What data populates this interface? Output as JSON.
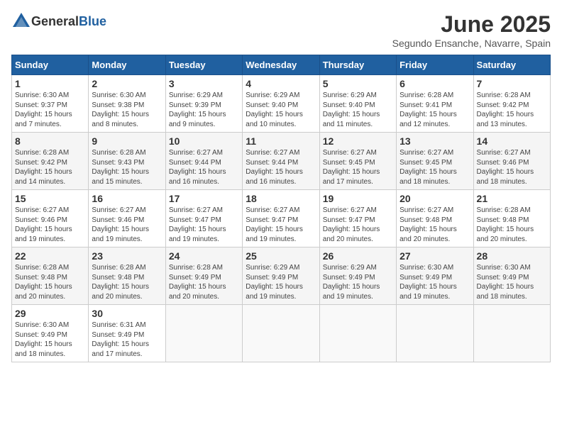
{
  "header": {
    "logo_general": "General",
    "logo_blue": "Blue",
    "month_title": "June 2025",
    "subtitle": "Segundo Ensanche, Navarre, Spain"
  },
  "weekdays": [
    "Sunday",
    "Monday",
    "Tuesday",
    "Wednesday",
    "Thursday",
    "Friday",
    "Saturday"
  ],
  "weeks": [
    [
      {
        "day": "1",
        "sunrise": "Sunrise: 6:30 AM",
        "sunset": "Sunset: 9:37 PM",
        "daylight": "Daylight: 15 hours and 7 minutes."
      },
      {
        "day": "2",
        "sunrise": "Sunrise: 6:30 AM",
        "sunset": "Sunset: 9:38 PM",
        "daylight": "Daylight: 15 hours and 8 minutes."
      },
      {
        "day": "3",
        "sunrise": "Sunrise: 6:29 AM",
        "sunset": "Sunset: 9:39 PM",
        "daylight": "Daylight: 15 hours and 9 minutes."
      },
      {
        "day": "4",
        "sunrise": "Sunrise: 6:29 AM",
        "sunset": "Sunset: 9:40 PM",
        "daylight": "Daylight: 15 hours and 10 minutes."
      },
      {
        "day": "5",
        "sunrise": "Sunrise: 6:29 AM",
        "sunset": "Sunset: 9:40 PM",
        "daylight": "Daylight: 15 hours and 11 minutes."
      },
      {
        "day": "6",
        "sunrise": "Sunrise: 6:28 AM",
        "sunset": "Sunset: 9:41 PM",
        "daylight": "Daylight: 15 hours and 12 minutes."
      },
      {
        "day": "7",
        "sunrise": "Sunrise: 6:28 AM",
        "sunset": "Sunset: 9:42 PM",
        "daylight": "Daylight: 15 hours and 13 minutes."
      }
    ],
    [
      {
        "day": "8",
        "sunrise": "Sunrise: 6:28 AM",
        "sunset": "Sunset: 9:42 PM",
        "daylight": "Daylight: 15 hours and 14 minutes."
      },
      {
        "day": "9",
        "sunrise": "Sunrise: 6:28 AM",
        "sunset": "Sunset: 9:43 PM",
        "daylight": "Daylight: 15 hours and 15 minutes."
      },
      {
        "day": "10",
        "sunrise": "Sunrise: 6:27 AM",
        "sunset": "Sunset: 9:44 PM",
        "daylight": "Daylight: 15 hours and 16 minutes."
      },
      {
        "day": "11",
        "sunrise": "Sunrise: 6:27 AM",
        "sunset": "Sunset: 9:44 PM",
        "daylight": "Daylight: 15 hours and 16 minutes."
      },
      {
        "day": "12",
        "sunrise": "Sunrise: 6:27 AM",
        "sunset": "Sunset: 9:45 PM",
        "daylight": "Daylight: 15 hours and 17 minutes."
      },
      {
        "day": "13",
        "sunrise": "Sunrise: 6:27 AM",
        "sunset": "Sunset: 9:45 PM",
        "daylight": "Daylight: 15 hours and 18 minutes."
      },
      {
        "day": "14",
        "sunrise": "Sunrise: 6:27 AM",
        "sunset": "Sunset: 9:46 PM",
        "daylight": "Daylight: 15 hours and 18 minutes."
      }
    ],
    [
      {
        "day": "15",
        "sunrise": "Sunrise: 6:27 AM",
        "sunset": "Sunset: 9:46 PM",
        "daylight": "Daylight: 15 hours and 19 minutes."
      },
      {
        "day": "16",
        "sunrise": "Sunrise: 6:27 AM",
        "sunset": "Sunset: 9:46 PM",
        "daylight": "Daylight: 15 hours and 19 minutes."
      },
      {
        "day": "17",
        "sunrise": "Sunrise: 6:27 AM",
        "sunset": "Sunset: 9:47 PM",
        "daylight": "Daylight: 15 hours and 19 minutes."
      },
      {
        "day": "18",
        "sunrise": "Sunrise: 6:27 AM",
        "sunset": "Sunset: 9:47 PM",
        "daylight": "Daylight: 15 hours and 19 minutes."
      },
      {
        "day": "19",
        "sunrise": "Sunrise: 6:27 AM",
        "sunset": "Sunset: 9:47 PM",
        "daylight": "Daylight: 15 hours and 20 minutes."
      },
      {
        "day": "20",
        "sunrise": "Sunrise: 6:27 AM",
        "sunset": "Sunset: 9:48 PM",
        "daylight": "Daylight: 15 hours and 20 minutes."
      },
      {
        "day": "21",
        "sunrise": "Sunrise: 6:28 AM",
        "sunset": "Sunset: 9:48 PM",
        "daylight": "Daylight: 15 hours and 20 minutes."
      }
    ],
    [
      {
        "day": "22",
        "sunrise": "Sunrise: 6:28 AM",
        "sunset": "Sunset: 9:48 PM",
        "daylight": "Daylight: 15 hours and 20 minutes."
      },
      {
        "day": "23",
        "sunrise": "Sunrise: 6:28 AM",
        "sunset": "Sunset: 9:48 PM",
        "daylight": "Daylight: 15 hours and 20 minutes."
      },
      {
        "day": "24",
        "sunrise": "Sunrise: 6:28 AM",
        "sunset": "Sunset: 9:49 PM",
        "daylight": "Daylight: 15 hours and 20 minutes."
      },
      {
        "day": "25",
        "sunrise": "Sunrise: 6:29 AM",
        "sunset": "Sunset: 9:49 PM",
        "daylight": "Daylight: 15 hours and 19 minutes."
      },
      {
        "day": "26",
        "sunrise": "Sunrise: 6:29 AM",
        "sunset": "Sunset: 9:49 PM",
        "daylight": "Daylight: 15 hours and 19 minutes."
      },
      {
        "day": "27",
        "sunrise": "Sunrise: 6:30 AM",
        "sunset": "Sunset: 9:49 PM",
        "daylight": "Daylight: 15 hours and 19 minutes."
      },
      {
        "day": "28",
        "sunrise": "Sunrise: 6:30 AM",
        "sunset": "Sunset: 9:49 PM",
        "daylight": "Daylight: 15 hours and 18 minutes."
      }
    ],
    [
      {
        "day": "29",
        "sunrise": "Sunrise: 6:30 AM",
        "sunset": "Sunset: 9:49 PM",
        "daylight": "Daylight: 15 hours and 18 minutes."
      },
      {
        "day": "30",
        "sunrise": "Sunrise: 6:31 AM",
        "sunset": "Sunset: 9:49 PM",
        "daylight": "Daylight: 15 hours and 17 minutes."
      },
      null,
      null,
      null,
      null,
      null
    ]
  ]
}
